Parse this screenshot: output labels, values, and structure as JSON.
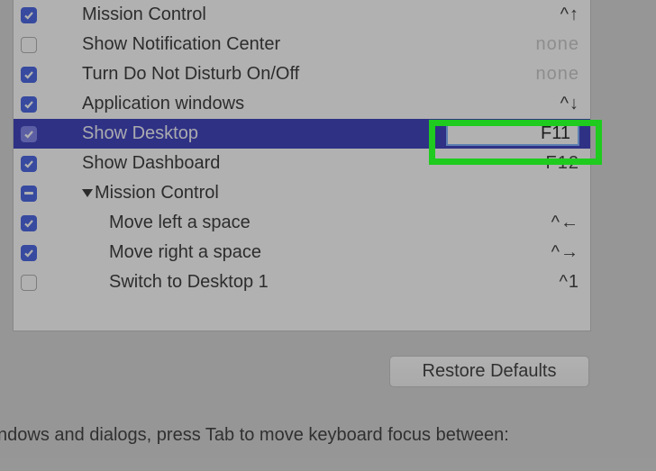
{
  "shortcuts": {
    "items": [
      {
        "label": "Mission Control",
        "key": "^↑",
        "checked": true,
        "dim": false
      },
      {
        "label": "Show Notification Center",
        "key": "none",
        "checked": false,
        "dim": true
      },
      {
        "label": "Turn Do Not Disturb On/Off",
        "key": "none",
        "checked": true,
        "dim": true
      },
      {
        "label": "Application windows",
        "key": "^↓",
        "checked": true,
        "dim": false
      },
      {
        "label": "Show Desktop",
        "key": "F11",
        "checked": true,
        "dim": false,
        "selected": true,
        "editing": true
      },
      {
        "label": "Show Dashboard",
        "key": "F12",
        "checked": true,
        "dim": false
      },
      {
        "label": "Mission Control",
        "group": true,
        "mixed": true
      },
      {
        "label": "Move left a space",
        "key": "^←",
        "checked": true,
        "dim": false,
        "sub": true
      },
      {
        "label": "Move right a space",
        "key": "^→",
        "checked": true,
        "dim": false,
        "sub": true
      },
      {
        "label": "Switch to Desktop 1",
        "key": "^1",
        "checked": false,
        "dim": false,
        "sub": true
      }
    ]
  },
  "buttons": {
    "restore_defaults": "Restore Defaults"
  },
  "footer": {
    "text": "ndows and dialogs, press Tab to move keyboard focus between:"
  }
}
